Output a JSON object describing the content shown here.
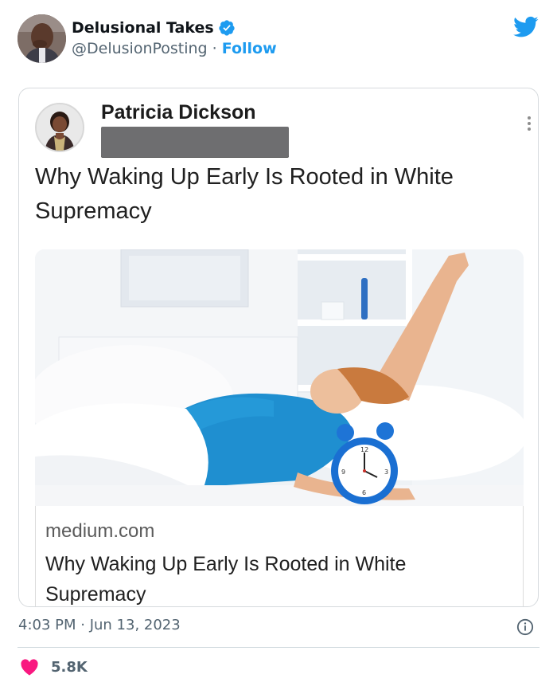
{
  "tweet": {
    "author": {
      "display_name": "Delusional Takes",
      "handle": "@DelusionPosting",
      "separator": " · ",
      "follow_label": "Follow",
      "verified": true
    },
    "timestamp": "4:03 PM · Jun 13, 2023",
    "likes": "5.8K"
  },
  "screenshot": {
    "author_name": "Patricia Dickson",
    "headline": "Why Waking Up Early Is Rooted in White Supremacy",
    "link_card": {
      "domain": "medium.com",
      "title": "Why Waking Up Early Is Rooted in White Supremacy"
    }
  },
  "icons": {
    "brand": "twitter-bird-icon",
    "verified": "verified-badge-icon",
    "info": "info-icon",
    "like": "heart-icon",
    "more": "more-vertical-icon"
  },
  "colors": {
    "twitter_blue": "#1d9bf0",
    "heart_red": "#f91880",
    "secondary_text": "#536471"
  }
}
